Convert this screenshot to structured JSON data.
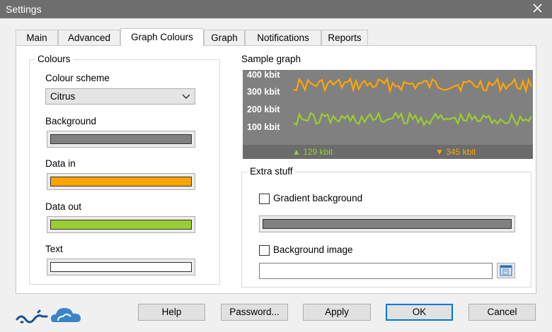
{
  "window": {
    "title": "Settings"
  },
  "tabs": [
    {
      "label": "Main"
    },
    {
      "label": "Advanced"
    },
    {
      "label": "Graph Colours"
    },
    {
      "label": "Graph"
    },
    {
      "label": "Notifications"
    },
    {
      "label": "Reports"
    }
  ],
  "active_tab": "Graph Colours",
  "colours": {
    "legend": "Colours",
    "scheme_label": "Colour scheme",
    "scheme_value": "Citrus",
    "background_label": "Background",
    "background_color": "#808080",
    "data_in_label": "Data in",
    "data_in_color": "#ffa500",
    "data_out_label": "Data out",
    "data_out_color": "#9acd32",
    "text_label": "Text",
    "text_color": "#ffffff"
  },
  "sample_graph": {
    "label": "Sample graph",
    "y_labels": [
      "400 kbit",
      "300 kbit",
      "200 kbit",
      "100 kbit"
    ],
    "in_status": "▲ 129 kbit",
    "out_status": "▼ 345 kbit",
    "in_color": "#9acd32",
    "out_color": "#ffa500"
  },
  "extra": {
    "legend": "Extra stuff",
    "gradient_label": "Gradient background",
    "gradient_checked": false,
    "gradient_color": "#808080",
    "bg_image_label": "Background image",
    "bg_image_checked": false,
    "bg_image_path": ""
  },
  "buttons": {
    "help": "Help",
    "password": "Password...",
    "apply": "Apply",
    "ok": "OK",
    "cancel": "Cancel"
  },
  "icons": {
    "close": "close-icon",
    "dropdown": "chevron-down-icon",
    "browse": "folder-browse-icon",
    "logo": "cloud-logo"
  }
}
